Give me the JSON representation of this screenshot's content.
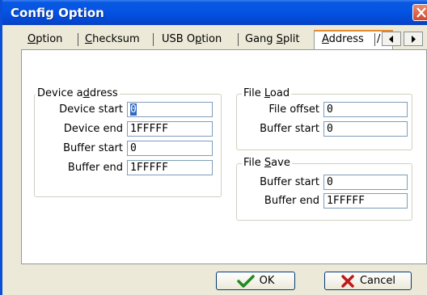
{
  "window": {
    "title": "Config Option"
  },
  "tabs": [
    {
      "label": "Option",
      "accel": "O",
      "rest": "ption"
    },
    {
      "label": "Checksum",
      "accel": "C",
      "rest": "hecksum"
    },
    {
      "label": "USB Option",
      "pre": "USB O",
      "accel": "p",
      "rest": "tion"
    },
    {
      "label": "Gang Split",
      "pre": "Gang ",
      "accel": "S",
      "rest": "plit"
    },
    {
      "label": "Address",
      "accel": "A",
      "rest": "ddress"
    },
    {
      "label": "/"
    }
  ],
  "device_address": {
    "title_pre": "Device a",
    "title_accel": "d",
    "title_rest": "dress",
    "device_start_label": "Device start",
    "device_start_value": "0",
    "device_end_label": "Device end",
    "device_end_value": "1FFFFF",
    "buffer_start_label": "Buffer start",
    "buffer_start_value": "0",
    "buffer_end_label": "Buffer end",
    "buffer_end_value": "1FFFFF"
  },
  "file_load": {
    "title_pre": "File ",
    "title_accel": "L",
    "title_rest": "oad",
    "file_offset_label": "File offset",
    "file_offset_value": "0",
    "buffer_start_label": "Buffer start",
    "buffer_start_value": "0"
  },
  "file_save": {
    "title_pre": "File ",
    "title_accel": "S",
    "title_rest": "ave",
    "buffer_start_label": "Buffer start",
    "buffer_start_value": "0",
    "buffer_end_label": "Buffer end",
    "buffer_end_value": "1FFFFF"
  },
  "buttons": {
    "ok": "OK",
    "cancel": "Cancel"
  },
  "icons": {
    "close": "close-icon",
    "scroll_left": "arrow-left-icon",
    "scroll_right": "arrow-right-icon",
    "ok": "checkmark-icon",
    "cancel": "x-icon"
  },
  "colors": {
    "titlebar": "#0554e4",
    "selection": "#316ac5",
    "active_tab": "#e68b2c"
  }
}
